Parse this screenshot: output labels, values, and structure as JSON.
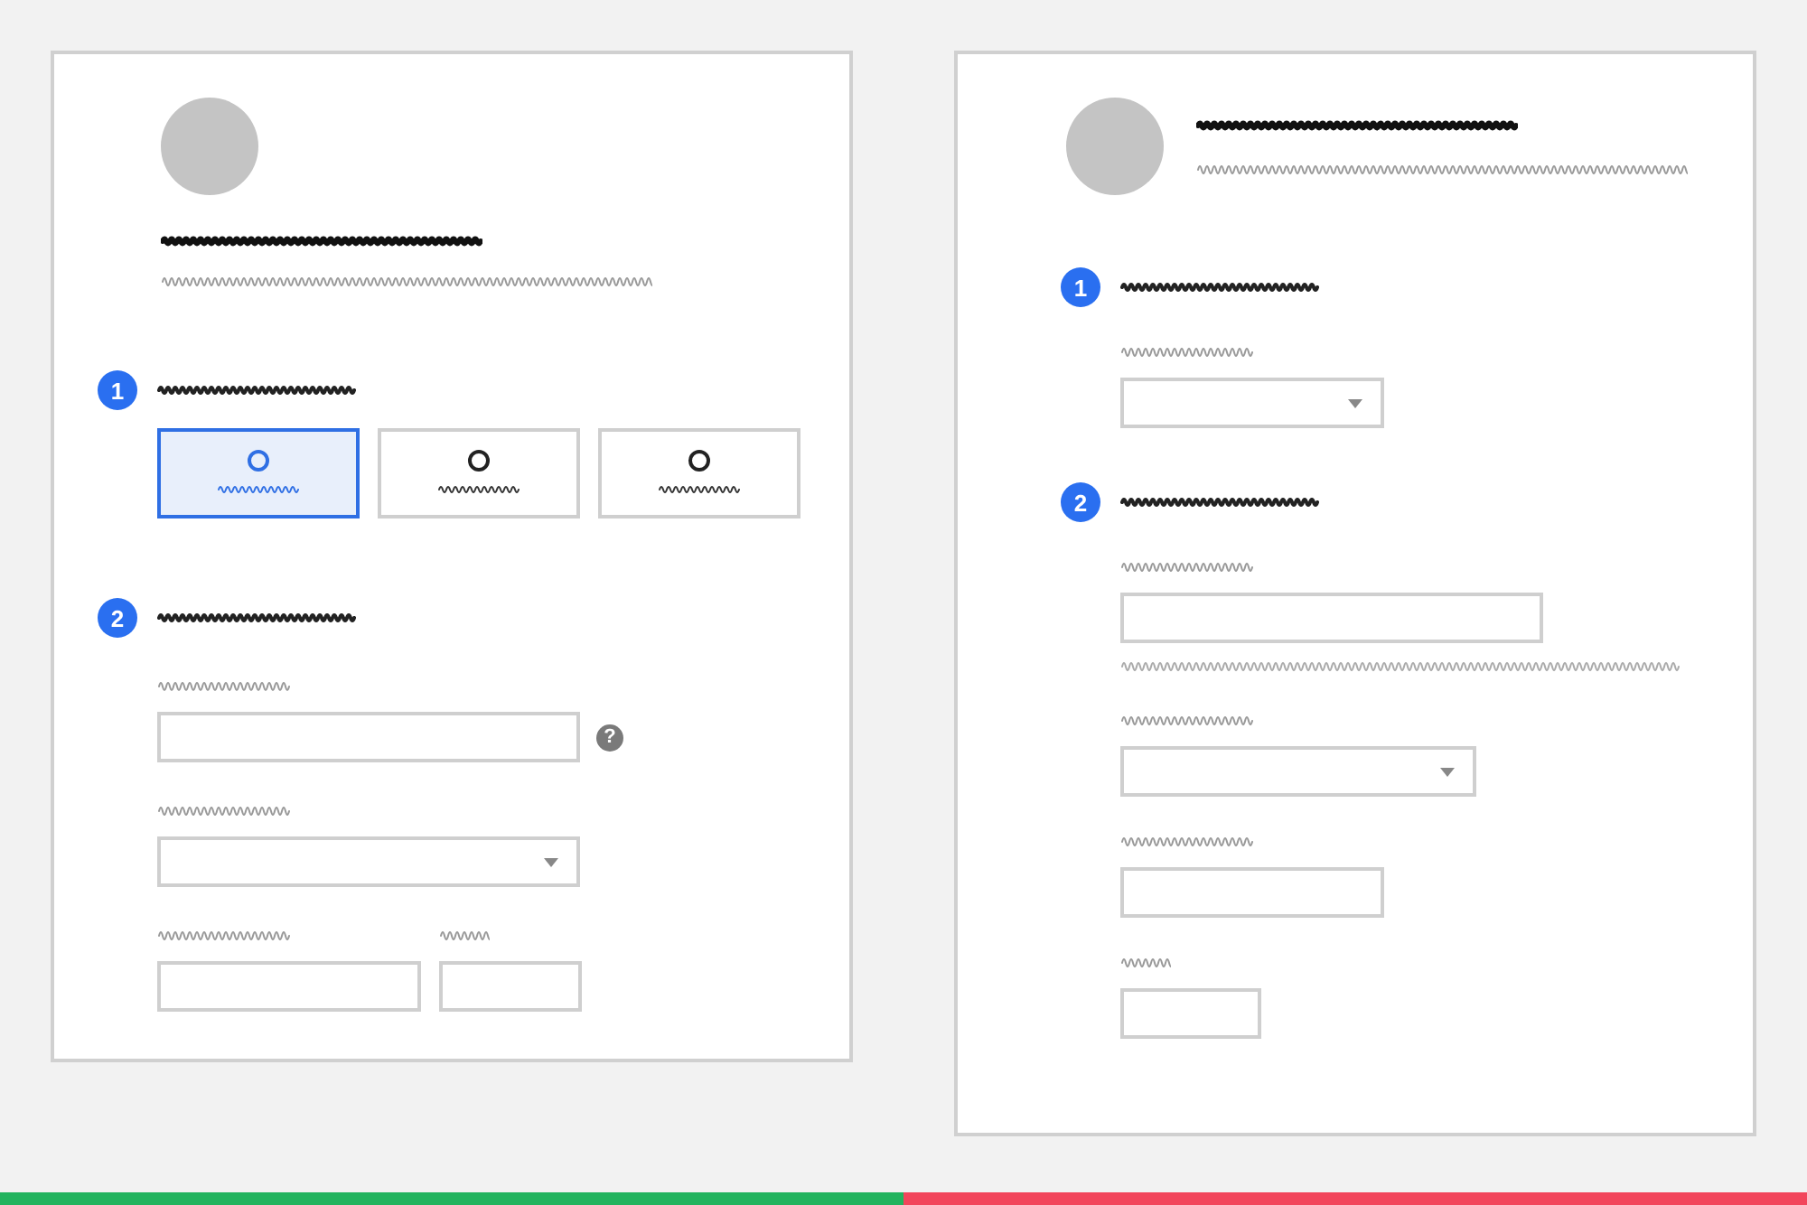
{
  "panels": [
    {
      "kind": "stacked",
      "sections": [
        {
          "number": "1",
          "fields": [
            {
              "kind": "choice",
              "options": [
                {
                  "selected": true
                },
                {
                  "selected": false
                },
                {
                  "selected": false
                }
              ]
            }
          ]
        },
        {
          "number": "2",
          "fields": [
            {
              "kind": "wide-input",
              "help": "?"
            },
            {
              "kind": "wide-select"
            },
            {
              "kind": "split-inputs"
            }
          ]
        }
      ]
    },
    {
      "kind": "inline",
      "sections": [
        {
          "number": "1",
          "fields": [
            {
              "kind": "short-select"
            }
          ]
        },
        {
          "number": "2",
          "fields": [
            {
              "kind": "wide-input",
              "hint": true
            },
            {
              "kind": "mid-select"
            },
            {
              "kind": "short-input"
            },
            {
              "kind": "tiny-input"
            }
          ]
        }
      ]
    }
  ],
  "verdict_bar": [
    {
      "color": "#22b35e"
    },
    {
      "color": "#f2455b"
    }
  ]
}
